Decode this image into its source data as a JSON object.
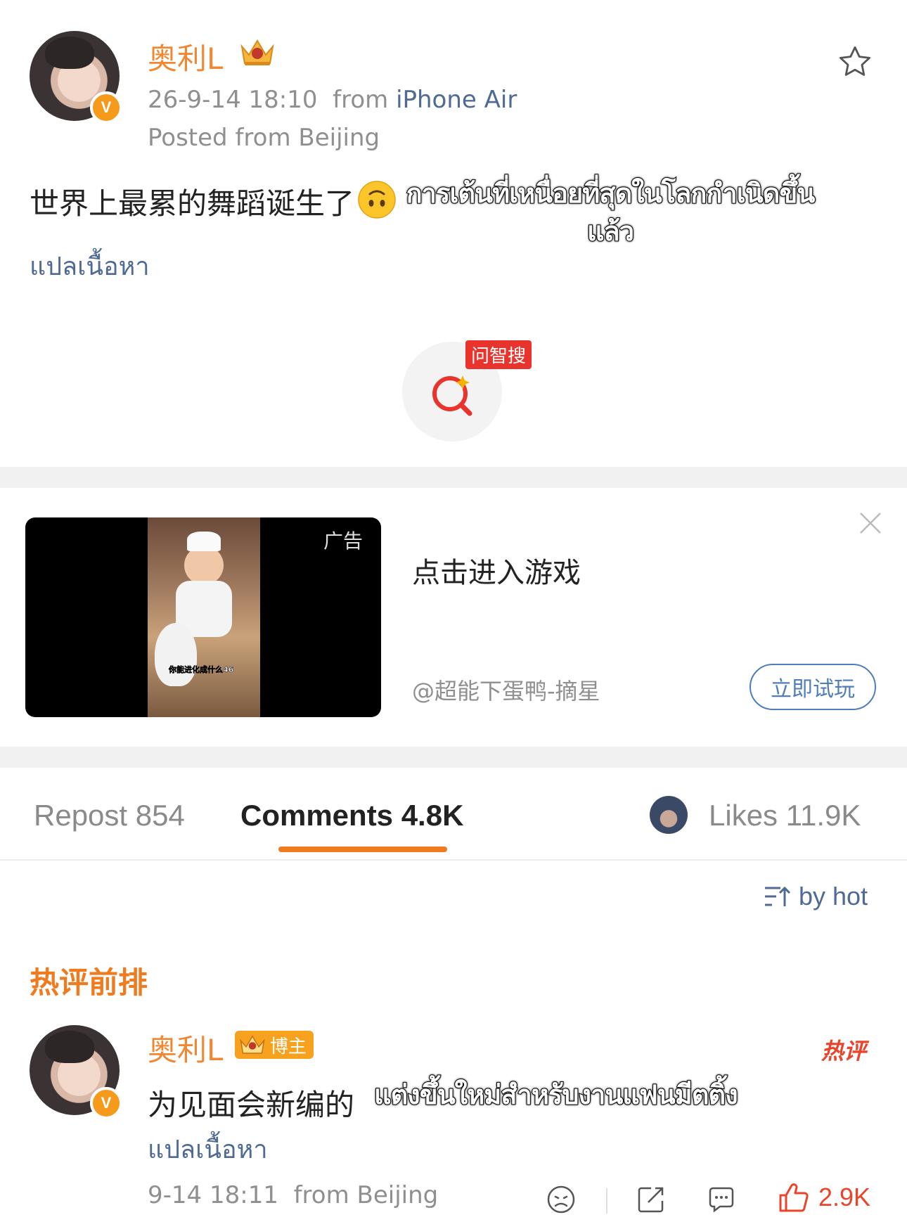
{
  "post": {
    "author": "奥利L",
    "date": "26-9-14 18:10",
    "from_label": "from",
    "device": "iPhone Air",
    "location": "Posted from Beijing",
    "text": "世界上最累的舞蹈诞生了",
    "emoji": "upside-down-face",
    "caption_overlay": "การเต้นที่เหนื่อยที่สุดในโลกกำเนิดขึ้นแล้ว",
    "translate_label": "แปลเนื้อหา",
    "search_badge": "问智搜"
  },
  "ad": {
    "tag": "广告",
    "title": "点击进入游戏",
    "source": "@超能下蛋鸭-摘星",
    "cta": "立即试玩",
    "thumb_caption": "你能进化成什么46"
  },
  "tabs": {
    "repost": "Repost 854",
    "comments": "Comments 4.8K",
    "likes": "Likes 11.9K"
  },
  "sort_label": "by hot",
  "hot_section_label": "热评前排",
  "comment": {
    "author": "奥利L",
    "badge": "博主",
    "hot_tag": "热评",
    "text": "为见面会新编的",
    "caption_overlay": "แต่งขึ้นใหม่สำหรับงานแฟนมีตติ้ง",
    "translate_label": "แปลเนื้อหา",
    "meta": "9-14 18:11  from Beijing",
    "likes": "2.9K"
  },
  "colors": {
    "accent_orange": "#f08733",
    "link_blue": "#4f6a93",
    "like_red": "#e8452c",
    "badge_red": "#e8342c"
  }
}
